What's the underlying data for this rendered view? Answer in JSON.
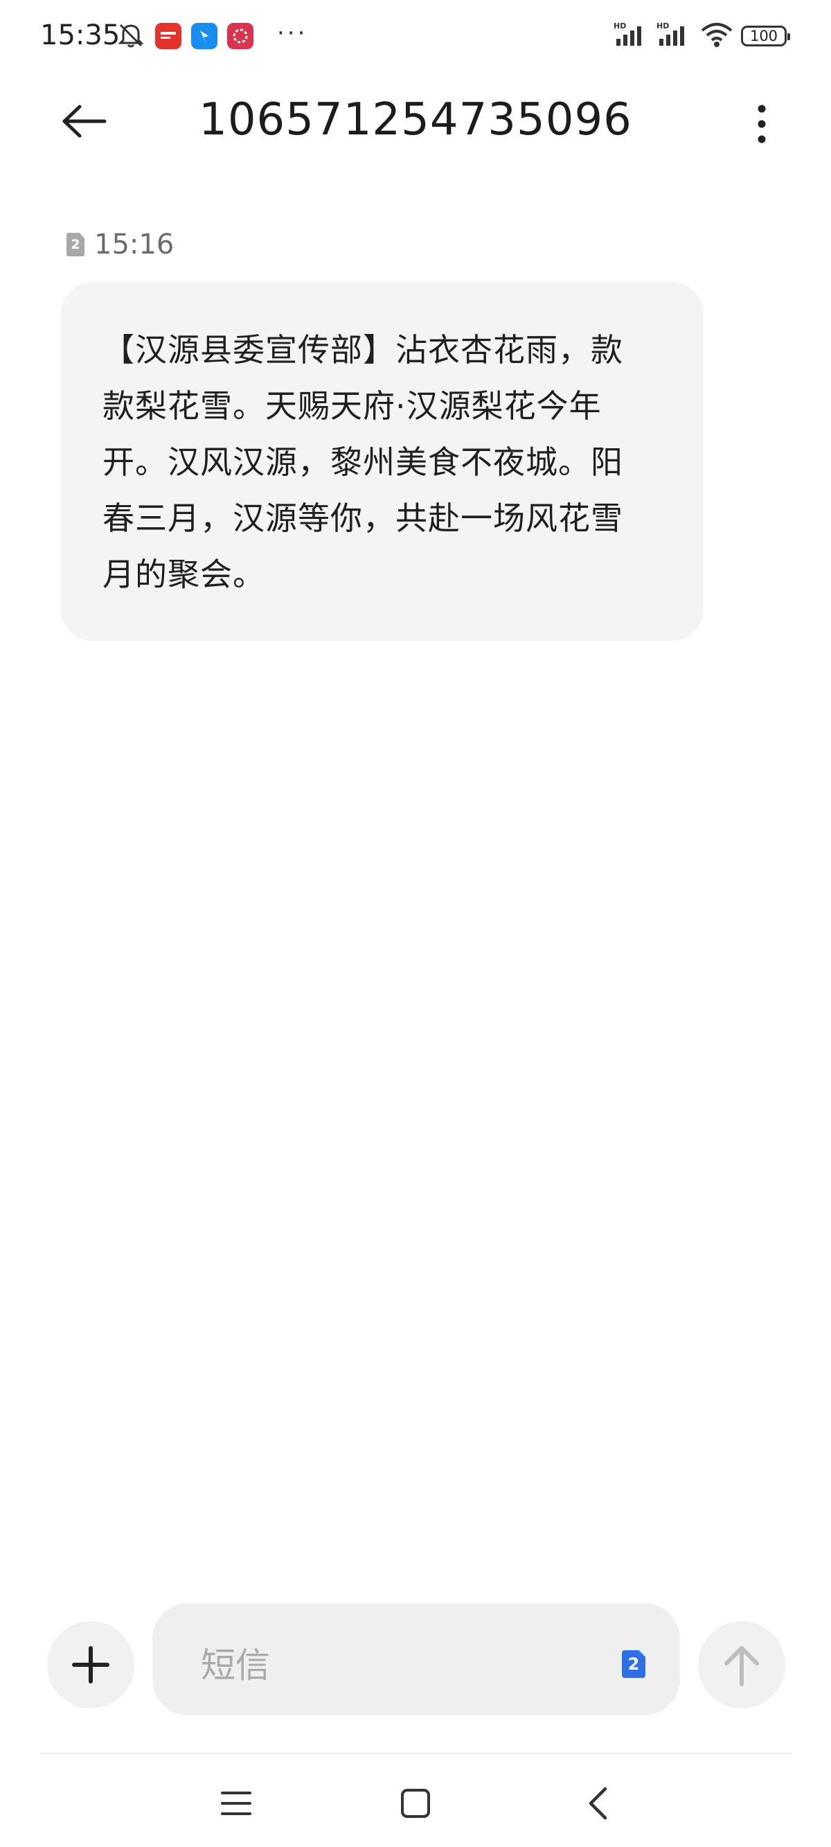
{
  "status_bar": {
    "time": "15:35",
    "battery": "100",
    "network_1": "HD",
    "network_2": "HD",
    "more": "···",
    "icons": [
      "mute-icon",
      "toutiao-app-icon",
      "blue-app-icon",
      "red-app-icon",
      "signal-icon",
      "wifi-icon",
      "battery-icon"
    ]
  },
  "header": {
    "title": "106571254735096",
    "back_icon": "arrow-left-icon",
    "menu_icon": "more-vertical-icon"
  },
  "message": {
    "sim_slot": "2",
    "time": "15:16",
    "lines": [
      "【汉源县委宣传部】沾衣杏花雨，款",
      "款梨花雪。天赐天府·汉源梨花今年",
      "开。汉风汉源，黎州美食不夜城。阳",
      "春三月，汉源等你，共赴一场风花雪",
      "月的聚会。"
    ]
  },
  "composer": {
    "placeholder": "短信",
    "sim_slot": "2",
    "add_icon": "plus-icon",
    "send_icon": "arrow-up-icon"
  },
  "nav": {
    "icons": [
      "menu-icon",
      "home-icon",
      "back-icon"
    ]
  },
  "colors": {
    "bubble": "#f4f4f4",
    "sim_accent": "#2f6fe4",
    "muted_text": "#6b6b6b"
  }
}
